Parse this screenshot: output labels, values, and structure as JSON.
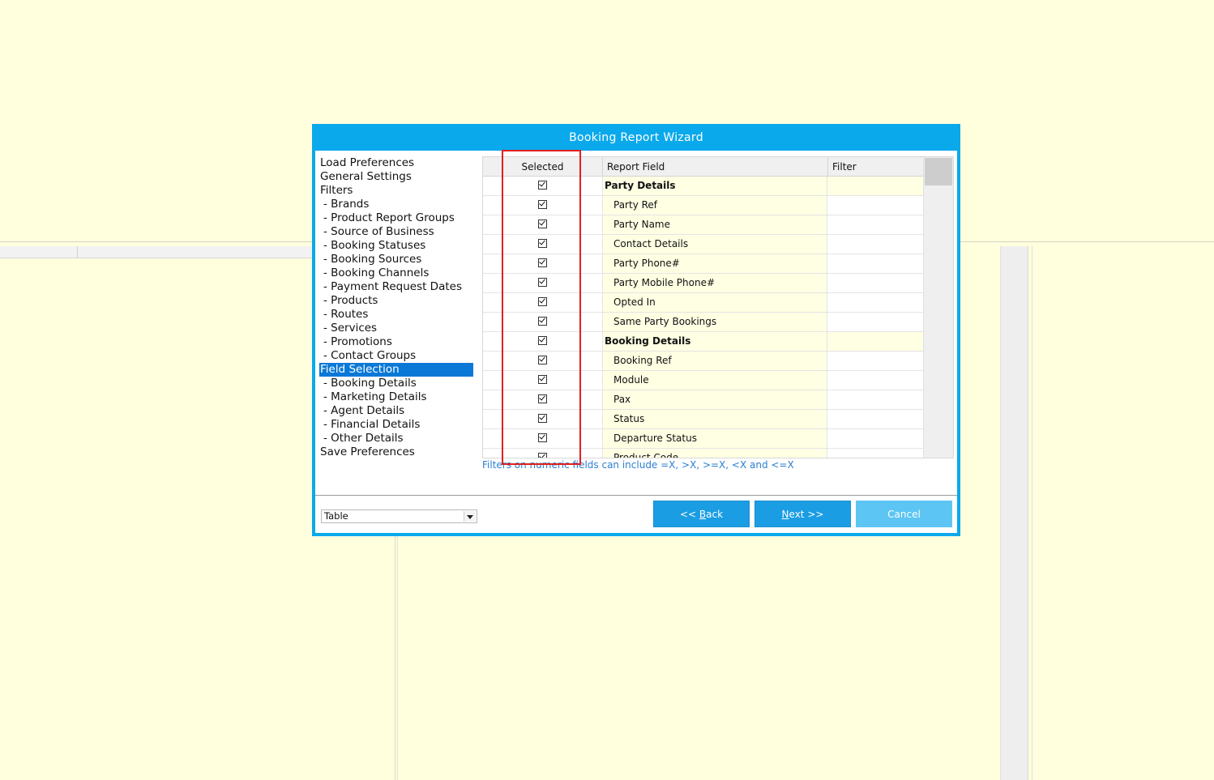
{
  "dialog": {
    "title": "Booking Report Wizard"
  },
  "nav": [
    {
      "label": "Load Preferences",
      "sub": false
    },
    {
      "label": "General Settings",
      "sub": false
    },
    {
      "label": "Filters",
      "sub": false
    },
    {
      "label": "- Brands",
      "sub": true
    },
    {
      "label": "- Product Report Groups",
      "sub": true
    },
    {
      "label": "- Source of Business",
      "sub": true
    },
    {
      "label": "- Booking Statuses",
      "sub": true
    },
    {
      "label": "- Booking Sources",
      "sub": true
    },
    {
      "label": "- Booking Channels",
      "sub": true
    },
    {
      "label": "- Payment Request Dates",
      "sub": true
    },
    {
      "label": "- Products",
      "sub": true
    },
    {
      "label": "- Routes",
      "sub": true
    },
    {
      "label": "- Services",
      "sub": true
    },
    {
      "label": "- Promotions",
      "sub": true
    },
    {
      "label": "- Contact Groups",
      "sub": true
    },
    {
      "label": "Field Selection",
      "sub": false,
      "active": true
    },
    {
      "label": "- Booking Details",
      "sub": true
    },
    {
      "label": "- Marketing Details",
      "sub": true
    },
    {
      "label": "- Agent Details",
      "sub": true
    },
    {
      "label": "- Financial Details",
      "sub": true
    },
    {
      "label": "- Other Details",
      "sub": true
    },
    {
      "label": "Save Preferences",
      "sub": false
    }
  ],
  "grid": {
    "columns": {
      "selected": "Selected",
      "field": "Report Field",
      "filter": "Filter"
    },
    "rows": [
      {
        "field": "Party Details",
        "group": true,
        "checked": true
      },
      {
        "field": "Party Ref",
        "group": false,
        "checked": true
      },
      {
        "field": "Party Name",
        "group": false,
        "checked": true
      },
      {
        "field": "Contact Details",
        "group": false,
        "checked": true
      },
      {
        "field": "Party Phone#",
        "group": false,
        "checked": true
      },
      {
        "field": "Party Mobile Phone#",
        "group": false,
        "checked": true
      },
      {
        "field": "Opted In",
        "group": false,
        "checked": true
      },
      {
        "field": "Same Party Bookings",
        "group": false,
        "checked": true
      },
      {
        "field": "Booking Details",
        "group": true,
        "checked": true
      },
      {
        "field": "Booking Ref",
        "group": false,
        "checked": true
      },
      {
        "field": "Module",
        "group": false,
        "checked": true
      },
      {
        "field": "Pax",
        "group": false,
        "checked": true
      },
      {
        "field": "Status",
        "group": false,
        "checked": true
      },
      {
        "field": "Departure Status",
        "group": false,
        "checked": true
      },
      {
        "field": "Product Code",
        "group": false,
        "checked": true
      }
    ]
  },
  "hint": "Filters on numeric fields can include =X, >X, >=X, <X and <=X",
  "output_select": {
    "value": "Table"
  },
  "buttons": {
    "back_prefix": "<< ",
    "back_key": "B",
    "back_rest": "ack",
    "next_prefix": "",
    "next_key": "N",
    "next_rest": "ext >>",
    "cancel": "Cancel"
  },
  "colors": {
    "accent": "#0aa9ec",
    "button": "#1a9de3",
    "cancel": "#5cc5f4",
    "highlight_box": "#e02020",
    "background": "#ffffdd"
  }
}
